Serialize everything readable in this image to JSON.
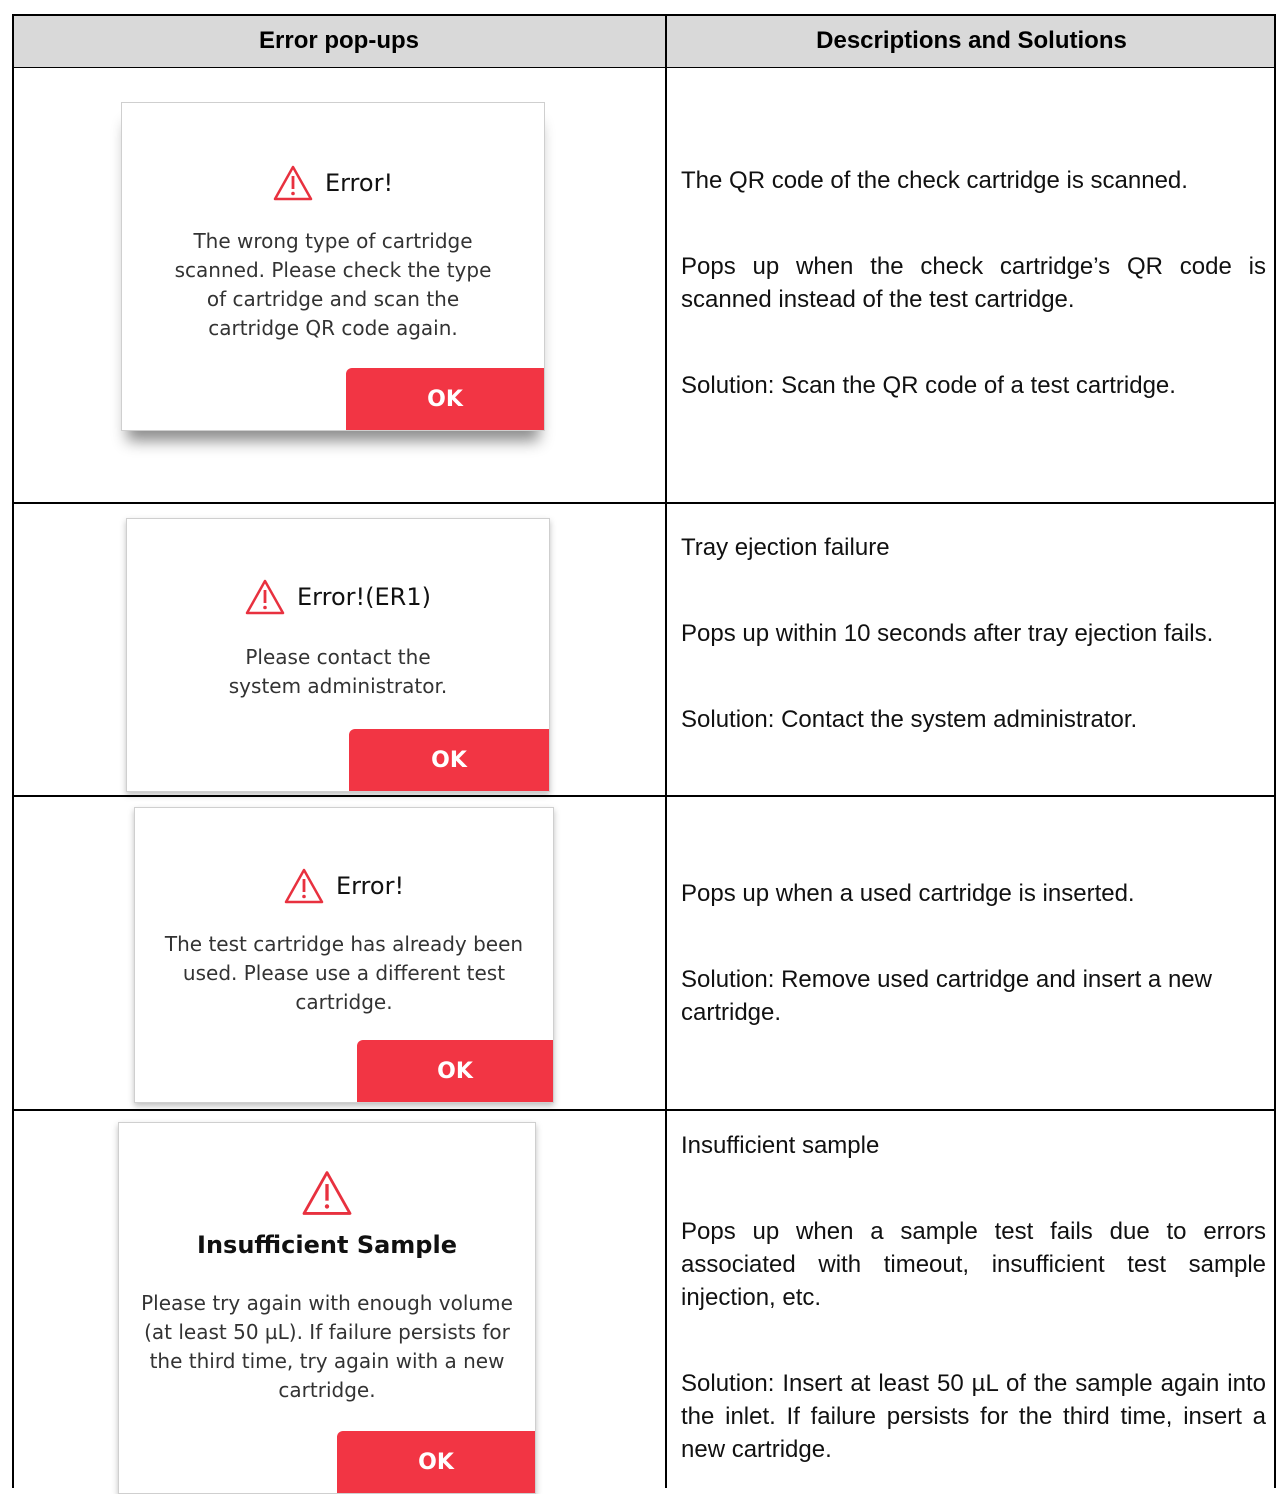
{
  "header": {
    "col1": "Error pop-ups",
    "col2": "Descriptions and Solutions"
  },
  "rows": [
    {
      "popup": {
        "icon": "warning-triangle-icon",
        "title": "Error!",
        "message": "The wrong type of cartridge scanned. Please check the type of cartridge and scan the cartridge QR code again.",
        "button": "OK"
      },
      "desc": [
        "The QR code of the check cartridge is scanned.",
        "Pops up when the check cartridge’s QR code is scanned instead of the test cartridge.",
        "Solution: Scan the QR code of a test cartridge."
      ]
    },
    {
      "popup": {
        "icon": "warning-triangle-icon",
        "title": "Error!(ER1)",
        "message": "Please contact the system administrator.",
        "button": "OK"
      },
      "desc": [
        "Tray ejection failure",
        "Pops up within 10 seconds after tray ejection fails.",
        "Solution: Contact the system administrator."
      ]
    },
    {
      "popup": {
        "icon": "warning-triangle-icon",
        "title": "Error!",
        "message": "The test cartridge has already been used. Please use a different test cartridge.",
        "button": "OK"
      },
      "desc": [
        "Pops up when a used cartridge is inserted.",
        "Solution: Remove used cartridge and insert a new cartridge."
      ]
    },
    {
      "popup": {
        "icon": "warning-triangle-icon",
        "title": "Insufficient Sample",
        "message": "Please try again with enough volume (at least 50 µL). If failure persists for the third time, try again with a new cartridge.",
        "button": "OK"
      },
      "desc": [
        "Insufficient sample",
        "Pops up when a sample test fails due to errors associated with timeout, insufficient test sample injection, etc.",
        "Solution: Insert at least 50 µL of the sample again into the inlet. If failure persists for the third time, insert a new cartridge."
      ]
    }
  ],
  "colors": {
    "accent": "#f23544",
    "header_bg": "#d9d9d9",
    "warning": "#e8313f"
  }
}
